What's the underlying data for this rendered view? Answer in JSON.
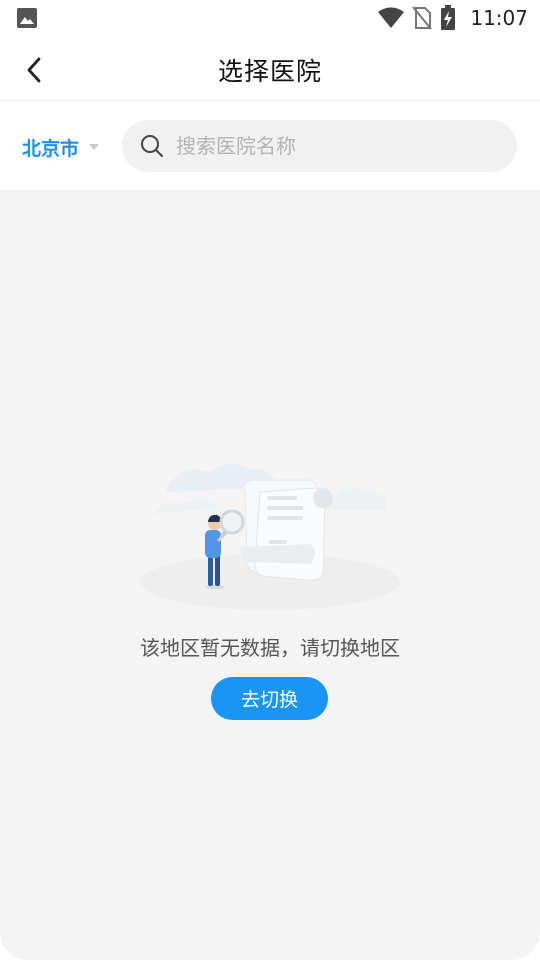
{
  "status_bar": {
    "time": "11:07",
    "icons": [
      "gallery-icon",
      "wifi-icon",
      "no-sim-icon",
      "battery-charging-icon"
    ]
  },
  "header": {
    "title": "选择医院",
    "back_icon": "chevron-left-icon"
  },
  "search": {
    "city": "北京市",
    "placeholder": "搜索医院名称",
    "value": ""
  },
  "empty_state": {
    "illustration": "person-with-magnifier-and-document",
    "message": "该地区暂无数据，请切换地区",
    "button_label": "去切换"
  },
  "colors": {
    "accent": "#1b95f5",
    "city_text": "#1b8cf0",
    "background": "#f4f4f4"
  }
}
